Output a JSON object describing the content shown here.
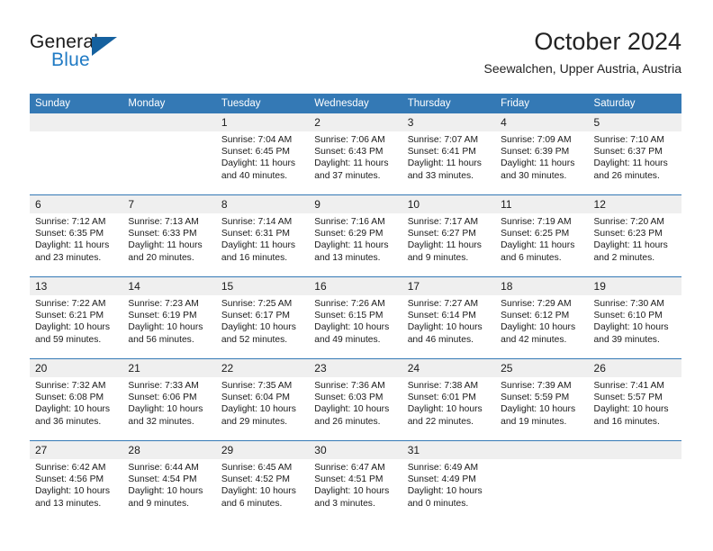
{
  "brand": {
    "name_top": "General",
    "name_bottom": "Blue",
    "triangle_color": "#15619f",
    "blue_text_color": "#1f7ac4"
  },
  "header": {
    "title": "October 2024",
    "subtitle": "Seewalchen, Upper Austria, Austria"
  },
  "theme": {
    "header_row_bg": "#3479b5",
    "header_row_text": "#ffffff",
    "daynum_bg": "#efefef",
    "cell_border": "#3479b5"
  },
  "weekdays": [
    "Sunday",
    "Monday",
    "Tuesday",
    "Wednesday",
    "Thursday",
    "Friday",
    "Saturday"
  ],
  "weeks": [
    [
      {
        "day": "",
        "sunrise": "",
        "sunset": "",
        "daylight": "",
        "blank": true
      },
      {
        "day": "",
        "sunrise": "",
        "sunset": "",
        "daylight": "",
        "blank": true
      },
      {
        "day": "1",
        "sunrise": "Sunrise: 7:04 AM",
        "sunset": "Sunset: 6:45 PM",
        "daylight": "Daylight: 11 hours and 40 minutes."
      },
      {
        "day": "2",
        "sunrise": "Sunrise: 7:06 AM",
        "sunset": "Sunset: 6:43 PM",
        "daylight": "Daylight: 11 hours and 37 minutes."
      },
      {
        "day": "3",
        "sunrise": "Sunrise: 7:07 AM",
        "sunset": "Sunset: 6:41 PM",
        "daylight": "Daylight: 11 hours and 33 minutes."
      },
      {
        "day": "4",
        "sunrise": "Sunrise: 7:09 AM",
        "sunset": "Sunset: 6:39 PM",
        "daylight": "Daylight: 11 hours and 30 minutes."
      },
      {
        "day": "5",
        "sunrise": "Sunrise: 7:10 AM",
        "sunset": "Sunset: 6:37 PM",
        "daylight": "Daylight: 11 hours and 26 minutes."
      }
    ],
    [
      {
        "day": "6",
        "sunrise": "Sunrise: 7:12 AM",
        "sunset": "Sunset: 6:35 PM",
        "daylight": "Daylight: 11 hours and 23 minutes."
      },
      {
        "day": "7",
        "sunrise": "Sunrise: 7:13 AM",
        "sunset": "Sunset: 6:33 PM",
        "daylight": "Daylight: 11 hours and 20 minutes."
      },
      {
        "day": "8",
        "sunrise": "Sunrise: 7:14 AM",
        "sunset": "Sunset: 6:31 PM",
        "daylight": "Daylight: 11 hours and 16 minutes."
      },
      {
        "day": "9",
        "sunrise": "Sunrise: 7:16 AM",
        "sunset": "Sunset: 6:29 PM",
        "daylight": "Daylight: 11 hours and 13 minutes."
      },
      {
        "day": "10",
        "sunrise": "Sunrise: 7:17 AM",
        "sunset": "Sunset: 6:27 PM",
        "daylight": "Daylight: 11 hours and 9 minutes."
      },
      {
        "day": "11",
        "sunrise": "Sunrise: 7:19 AM",
        "sunset": "Sunset: 6:25 PM",
        "daylight": "Daylight: 11 hours and 6 minutes."
      },
      {
        "day": "12",
        "sunrise": "Sunrise: 7:20 AM",
        "sunset": "Sunset: 6:23 PM",
        "daylight": "Daylight: 11 hours and 2 minutes."
      }
    ],
    [
      {
        "day": "13",
        "sunrise": "Sunrise: 7:22 AM",
        "sunset": "Sunset: 6:21 PM",
        "daylight": "Daylight: 10 hours and 59 minutes."
      },
      {
        "day": "14",
        "sunrise": "Sunrise: 7:23 AM",
        "sunset": "Sunset: 6:19 PM",
        "daylight": "Daylight: 10 hours and 56 minutes."
      },
      {
        "day": "15",
        "sunrise": "Sunrise: 7:25 AM",
        "sunset": "Sunset: 6:17 PM",
        "daylight": "Daylight: 10 hours and 52 minutes."
      },
      {
        "day": "16",
        "sunrise": "Sunrise: 7:26 AM",
        "sunset": "Sunset: 6:15 PM",
        "daylight": "Daylight: 10 hours and 49 minutes."
      },
      {
        "day": "17",
        "sunrise": "Sunrise: 7:27 AM",
        "sunset": "Sunset: 6:14 PM",
        "daylight": "Daylight: 10 hours and 46 minutes."
      },
      {
        "day": "18",
        "sunrise": "Sunrise: 7:29 AM",
        "sunset": "Sunset: 6:12 PM",
        "daylight": "Daylight: 10 hours and 42 minutes."
      },
      {
        "day": "19",
        "sunrise": "Sunrise: 7:30 AM",
        "sunset": "Sunset: 6:10 PM",
        "daylight": "Daylight: 10 hours and 39 minutes."
      }
    ],
    [
      {
        "day": "20",
        "sunrise": "Sunrise: 7:32 AM",
        "sunset": "Sunset: 6:08 PM",
        "daylight": "Daylight: 10 hours and 36 minutes."
      },
      {
        "day": "21",
        "sunrise": "Sunrise: 7:33 AM",
        "sunset": "Sunset: 6:06 PM",
        "daylight": "Daylight: 10 hours and 32 minutes."
      },
      {
        "day": "22",
        "sunrise": "Sunrise: 7:35 AM",
        "sunset": "Sunset: 6:04 PM",
        "daylight": "Daylight: 10 hours and 29 minutes."
      },
      {
        "day": "23",
        "sunrise": "Sunrise: 7:36 AM",
        "sunset": "Sunset: 6:03 PM",
        "daylight": "Daylight: 10 hours and 26 minutes."
      },
      {
        "day": "24",
        "sunrise": "Sunrise: 7:38 AM",
        "sunset": "Sunset: 6:01 PM",
        "daylight": "Daylight: 10 hours and 22 minutes."
      },
      {
        "day": "25",
        "sunrise": "Sunrise: 7:39 AM",
        "sunset": "Sunset: 5:59 PM",
        "daylight": "Daylight: 10 hours and 19 minutes."
      },
      {
        "day": "26",
        "sunrise": "Sunrise: 7:41 AM",
        "sunset": "Sunset: 5:57 PM",
        "daylight": "Daylight: 10 hours and 16 minutes."
      }
    ],
    [
      {
        "day": "27",
        "sunrise": "Sunrise: 6:42 AM",
        "sunset": "Sunset: 4:56 PM",
        "daylight": "Daylight: 10 hours and 13 minutes."
      },
      {
        "day": "28",
        "sunrise": "Sunrise: 6:44 AM",
        "sunset": "Sunset: 4:54 PM",
        "daylight": "Daylight: 10 hours and 9 minutes."
      },
      {
        "day": "29",
        "sunrise": "Sunrise: 6:45 AM",
        "sunset": "Sunset: 4:52 PM",
        "daylight": "Daylight: 10 hours and 6 minutes."
      },
      {
        "day": "30",
        "sunrise": "Sunrise: 6:47 AM",
        "sunset": "Sunset: 4:51 PM",
        "daylight": "Daylight: 10 hours and 3 minutes."
      },
      {
        "day": "31",
        "sunrise": "Sunrise: 6:49 AM",
        "sunset": "Sunset: 4:49 PM",
        "daylight": "Daylight: 10 hours and 0 minutes."
      },
      {
        "day": "",
        "sunrise": "",
        "sunset": "",
        "daylight": "",
        "blank": true
      },
      {
        "day": "",
        "sunrise": "",
        "sunset": "",
        "daylight": "",
        "blank": true
      }
    ]
  ]
}
